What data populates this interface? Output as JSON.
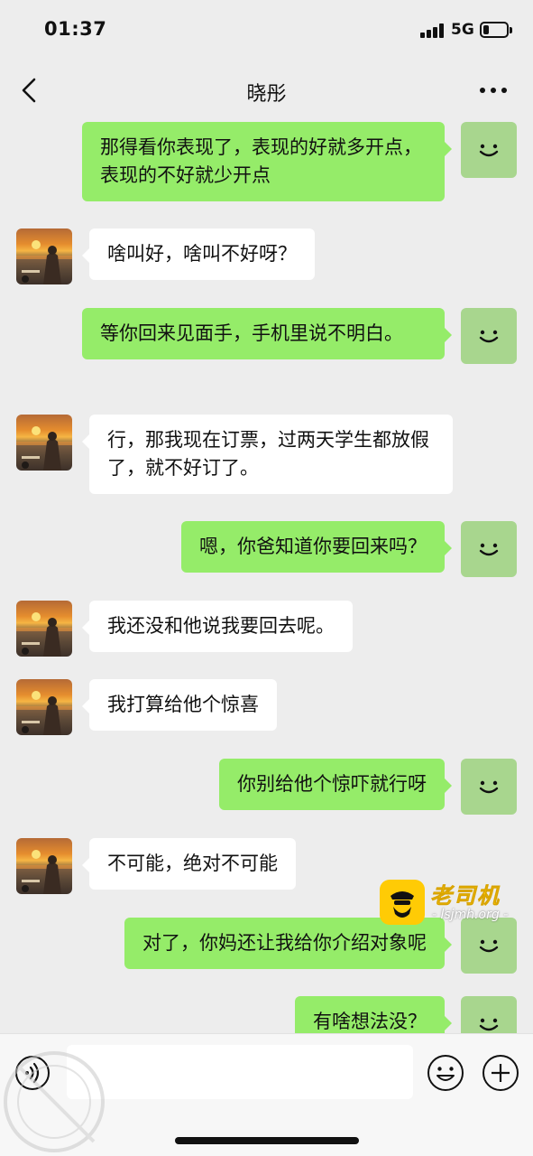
{
  "status_bar": {
    "time": "01:37",
    "network": "5G",
    "battery_level": 0.25
  },
  "nav": {
    "title": "晓彤",
    "back_icon": "chevron-left-icon",
    "more_icon": "ellipsis-icon"
  },
  "messages": [
    {
      "side": "right",
      "text": "那得看你表现了，表现的好就多开点，表现的不好就少开点"
    },
    {
      "side": "left",
      "text": "啥叫好，啥叫不好呀？"
    },
    {
      "side": "right",
      "text": "等你回来见面手，手机里说不明白。"
    },
    {
      "side": "left",
      "text": "行，那我现在订票，过两天学生都放假了，就不好订了。"
    },
    {
      "side": "right",
      "text": "嗯，你爸知道你要回来吗？"
    },
    {
      "side": "left",
      "text": "我还没和他说我要回去呢。"
    },
    {
      "side": "left",
      "text": "我打算给他个惊喜"
    },
    {
      "side": "right",
      "text": "你别给他个惊吓就行呀"
    },
    {
      "side": "left",
      "text": "不可能，绝对不可能"
    },
    {
      "side": "right",
      "text": "对了，你妈还让我给你介绍对象呢"
    },
    {
      "side": "right",
      "text": "有啥想法没？"
    }
  ],
  "watermark": {
    "brand": "老司机",
    "url": "- lsjmh.org -"
  },
  "input_bar": {
    "voice_icon": "voice-icon",
    "emoji_icon": "emoji-icon",
    "plus_icon": "plus-icon",
    "value": ""
  },
  "colors": {
    "background": "#ededed",
    "self_bubble": "#95ec69",
    "other_bubble": "#ffffff",
    "self_avatar": "#a8d68e",
    "watermark_brand": "#ffcb05"
  }
}
